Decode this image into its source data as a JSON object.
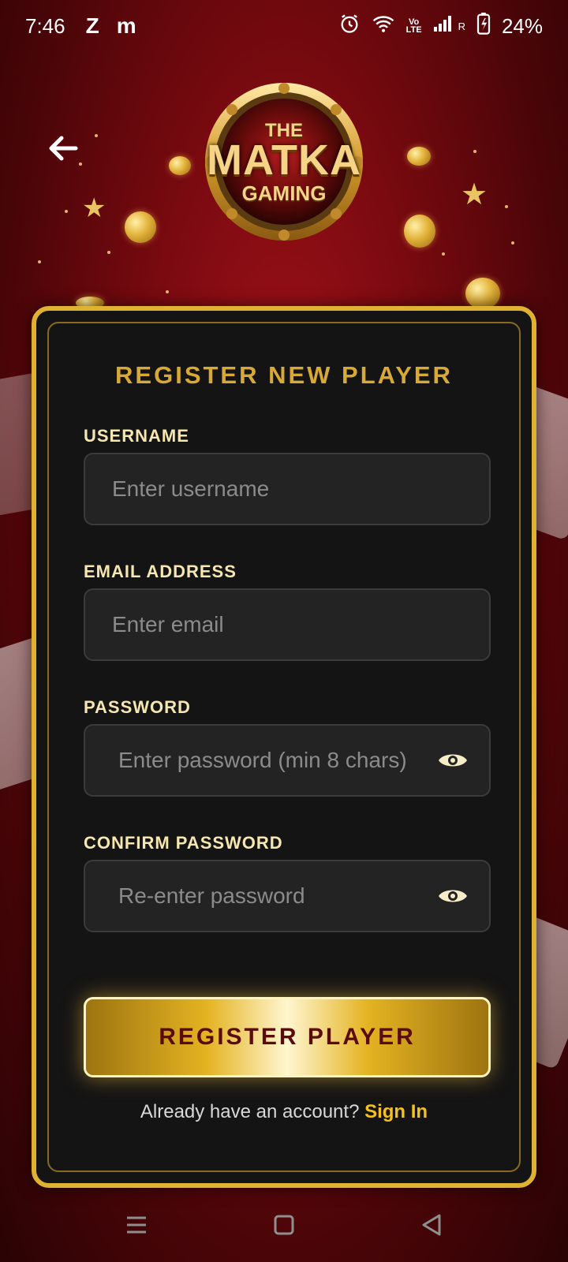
{
  "status_bar": {
    "time": "7:46",
    "app_icons": [
      "Z",
      "m"
    ],
    "battery": "24%",
    "volte_label": "Vo LTE",
    "signal_suffix": "R"
  },
  "logo": {
    "line1": "THE",
    "line2": "MATKA",
    "line3": "GAMING"
  },
  "form": {
    "title": "REGISTER NEW PLAYER",
    "username": {
      "label": "USERNAME",
      "placeholder": "Enter username",
      "value": ""
    },
    "email": {
      "label": "EMAIL ADDRESS",
      "placeholder": "Enter email",
      "value": ""
    },
    "password": {
      "label": "PASSWORD",
      "placeholder": "Enter password (min 8 chars)",
      "value": ""
    },
    "confirm_password": {
      "label": "CONFIRM PASSWORD",
      "placeholder": "Re-enter password",
      "value": ""
    },
    "submit_label": "REGISTER PLAYER",
    "signin_prompt": "Already have an account?",
    "signin_link": "Sign In"
  },
  "colors": {
    "accent_gold": "#e0b232",
    "title_gold": "#d9a935",
    "link_yellow": "#f4c21f",
    "button_text": "#5a0b0b",
    "background_red": "#7a0a10"
  },
  "icons": {
    "back": "arrow-left-icon",
    "eye": "eye-icon",
    "nav_menu": "menu-icon",
    "nav_home": "square-home-icon",
    "nav_back": "triangle-back-icon"
  }
}
